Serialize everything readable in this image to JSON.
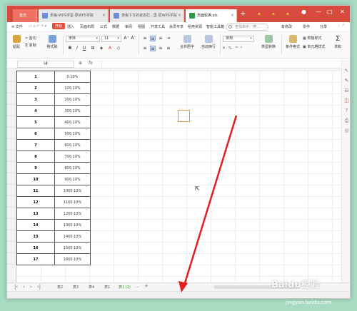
{
  "tabs": {
    "home": "首页",
    "t1": "表格-WPS学堂-原WPS学院",
    "t2": "表格下方的状态栏...里-原WPS学院",
    "t3": "页面轮换.xls"
  },
  "menu": {
    "file": "≡ 文件",
    "items": [
      "开始",
      "插入",
      "页面布局",
      "公式",
      "数据",
      "审阅",
      "视图",
      "开发工具",
      "会员专享",
      "稻壳资源",
      "智能工具箱"
    ],
    "search": "查找命令、搜...",
    "right": [
      "有修改",
      "协作",
      "分享"
    ]
  },
  "ribbon": {
    "paste": "粘贴",
    "cut": "剪切",
    "copy": "复制",
    "format_painter": "格式刷",
    "font": "宋体",
    "size": "11",
    "merge": "合并居中",
    "wrap": "自动换行",
    "number_format": "常规",
    "cond_format": "条件格式",
    "table_style": "表格样式",
    "cell_style": "单元格样式",
    "sum": "求和",
    "type_convert": "类型转换"
  },
  "formula_bar": {
    "name_box": "I4",
    "fx": "fx"
  },
  "rows": [
    {
      "n": "1",
      "v": "0.10%"
    },
    {
      "n": "2",
      "v": "100.10%"
    },
    {
      "n": "3",
      "v": "200.10%"
    },
    {
      "n": "4",
      "v": "300.10%"
    },
    {
      "n": "5",
      "v": "400.10%"
    },
    {
      "n": "6",
      "v": "500.10%"
    },
    {
      "n": "7",
      "v": "600.10%"
    },
    {
      "n": "8",
      "v": "700.10%"
    },
    {
      "n": "9",
      "v": "800.10%"
    },
    {
      "n": "10",
      "v": "900.10%"
    },
    {
      "n": "11",
      "v": "1000.10%"
    },
    {
      "n": "12",
      "v": "1100.10%"
    },
    {
      "n": "13",
      "v": "1200.10%"
    },
    {
      "n": "14",
      "v": "1300.10%"
    },
    {
      "n": "15",
      "v": "1400.10%"
    },
    {
      "n": "16",
      "v": "1500.10%"
    },
    {
      "n": "17",
      "v": "1600.10%"
    }
  ],
  "sheets": [
    "表2",
    "表3",
    "表4",
    "表1",
    "表1 (2)",
    "..."
  ],
  "watermark": {
    "text": "Baidu经验",
    "url": "jingyan.baidu.com"
  },
  "colors": {
    "accent": "#d84a3e",
    "arrow": "#e02020",
    "selection": "#e39a3c"
  }
}
